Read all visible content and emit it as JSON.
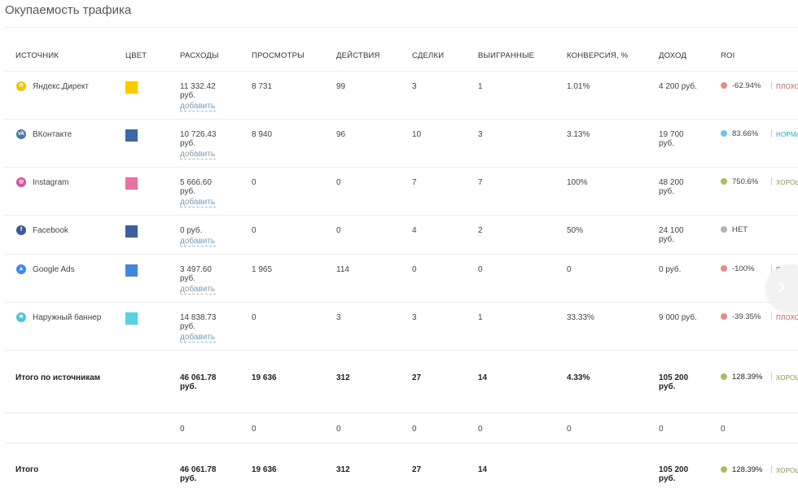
{
  "title": "Окупаемость трафика",
  "columns": [
    "ИСТОЧНИК",
    "ЦВЕТ",
    "РАСХОДЫ",
    "ПРОСМОТРЫ",
    "ДЕЙСТВИЯ",
    "СДЕЛКИ",
    "ВЫИГРАННЫЕ",
    "КОНВЕРСИЯ, %",
    "ДОХОД",
    "ROI"
  ],
  "add_label": "добавить",
  "rows": [
    {
      "icon": "yandex-icon",
      "icon_glyph": "Я",
      "icon_color": "#f2c200",
      "name": "Яндекс.Директ",
      "swatch": "#f7cc00",
      "cost1": "11 332.42",
      "cost2": "руб.",
      "views": "8 731",
      "actions": "99",
      "deals": "3",
      "won": "1",
      "conv": "1.01%",
      "inc1": "4 200 руб.",
      "inc2": "",
      "dot": "#e98a85",
      "roi": "-62.94%",
      "status": "ПЛОХО",
      "status_color": "#d9534f"
    },
    {
      "icon": "vk-icon",
      "icon_glyph": "vk",
      "icon_color": "#4a76a8",
      "name": "ВКонтакте",
      "swatch": "#3d67a8",
      "cost1": "10 726.43",
      "cost2": "руб.",
      "views": "8 940",
      "actions": "96",
      "deals": "10",
      "won": "3",
      "conv": "3.13%",
      "inc1": "19 700",
      "inc2": "руб.",
      "dot": "#6dc6e8",
      "roi": "83.66%",
      "status": "НОРМАЛЬНО",
      "status_color": "#2fa9d4"
    },
    {
      "icon": "instagram-icon",
      "icon_glyph": "◎",
      "icon_color": "#d6539b",
      "name": "Instagram",
      "swatch": "#e573a4",
      "cost1": "5 666.60",
      "cost2": "руб.",
      "views": "0",
      "actions": "0",
      "deals": "7",
      "won": "7",
      "conv": "100%",
      "inc1": "48 200",
      "inc2": "руб.",
      "dot": "#a8c05a",
      "roi": "750.6%",
      "status": "ХОРОШО",
      "status_color": "#7fa32e"
    },
    {
      "icon": "facebook-icon",
      "icon_glyph": "f",
      "icon_color": "#3b5998",
      "name": "Facebook",
      "swatch": "#3d5f9e",
      "cost1": "0 руб.",
      "cost2": "",
      "views": "0",
      "actions": "0",
      "deals": "4",
      "won": "2",
      "conv": "50%",
      "inc1": "24 100",
      "inc2": "руб.",
      "dot": "#b3b3b3",
      "roi": "НЕТ",
      "status": "",
      "status_color": "#555"
    },
    {
      "icon": "google-ads-icon",
      "icon_glyph": "▲",
      "icon_color": "#4285f4",
      "name": "Google Ads",
      "swatch": "#3f88db",
      "cost1": "3 497.60",
      "cost2": "руб.",
      "views": "1 965",
      "actions": "114",
      "deals": "0",
      "won": "0",
      "conv": "0",
      "inc1": "0 руб.",
      "inc2": "",
      "dot": "#e98a85",
      "roi": "-100%",
      "status": "ПЛОХО",
      "status_color": "#d9534f"
    },
    {
      "icon": "star-icon",
      "icon_glyph": "★",
      "icon_color": "#4cc6d8",
      "name": "Наружный баннер",
      "swatch": "#5dd0e0",
      "cost1": "14 838.73",
      "cost2": "руб.",
      "views": "0",
      "actions": "3",
      "deals": "3",
      "won": "1",
      "conv": "33.33%",
      "inc1": "9 000 руб.",
      "inc2": "",
      "dot": "#e98a85",
      "roi": "-39.35%",
      "status": "ПЛОХО",
      "status_color": "#d9534f"
    }
  ],
  "subtotal": {
    "label": "Итого по источникам",
    "cost1": "46 061.78",
    "cost2": "руб.",
    "views": "19 636",
    "actions": "312",
    "deals": "27",
    "won": "14",
    "conv": "4.33%",
    "inc1": "105 200",
    "inc2": "руб.",
    "dot": "#a8c05a",
    "roi": "128.39%",
    "status": "ХОРОШО",
    "status_color": "#7fa32e"
  },
  "other": {
    "cost": "0",
    "views": "0",
    "actions": "0",
    "deals": "0",
    "won": "0",
    "conv": "0",
    "inc": "0",
    "roi": "0"
  },
  "total": {
    "label": "Итого",
    "cost1": "46 061.78",
    "cost2": "руб.",
    "views": "19 636",
    "actions": "312",
    "deals": "27",
    "won": "14",
    "inc1": "105 200",
    "inc2": "руб.",
    "dot": "#a8c05a",
    "roi": "128.39%",
    "status": "ХОРОШО",
    "status_color": "#7fa32e"
  },
  "next_glyph": "›"
}
